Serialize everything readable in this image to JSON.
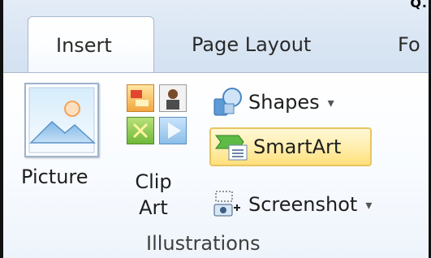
{
  "snippet": "Q.",
  "tabs": {
    "insert": "Insert",
    "page_layout": "Page Layout",
    "fo": "Fo"
  },
  "illustrations": {
    "picture_label": "Picture",
    "clip_art_label_1": "Clip",
    "clip_art_label_2": "Art",
    "shapes_label": "Shapes",
    "smartart_label": "SmartArt",
    "screenshot_label": "Screenshot",
    "group_label": "Illustrations"
  },
  "colors": {
    "hover_highlight": "#ffe07a",
    "tab_border": "#aab9cf"
  }
}
